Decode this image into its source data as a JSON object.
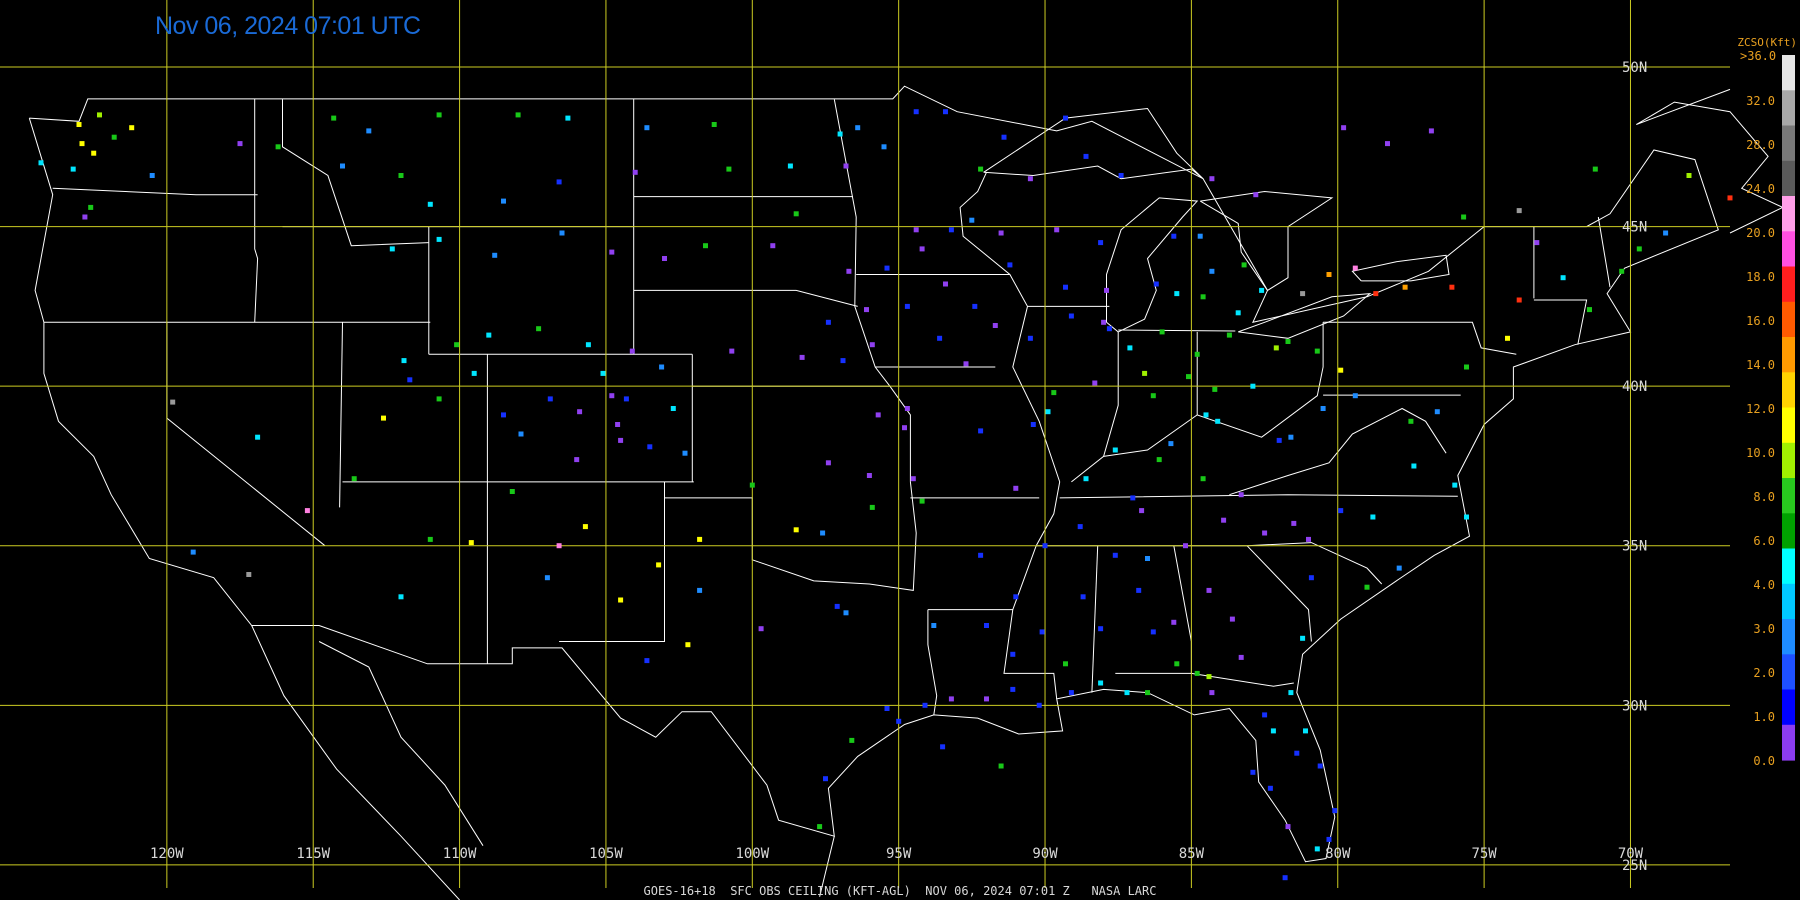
{
  "header": {
    "timestamp": "Nov 06, 2024 07:01 UTC"
  },
  "footer": {
    "caption": "GOES-16+18  SFC OBS CEILING (KFT-AGL)  NOV 06, 2024 07:01 Z   NASA LARC"
  },
  "map": {
    "projection": "equirectangular",
    "lon_range": [
      -125.7,
      -66.6
    ],
    "lat_range": [
      23.9,
      52.1
    ],
    "grid_color": "#cccc22",
    "border_color": "#ffffff",
    "longitude_lines": [
      -120,
      -115,
      -110,
      -105,
      -100,
      -95,
      -90,
      -85,
      -80,
      -75,
      -70
    ],
    "latitude_lines": [
      25,
      30,
      35,
      40,
      45,
      50
    ],
    "longitude_labels": [
      "120W",
      "115W",
      "110W",
      "105W",
      "100W",
      "95W",
      "90W",
      "85W",
      "80W",
      "75W",
      "70W"
    ],
    "latitude_labels": [
      "25N",
      "30N",
      "35N",
      "40N",
      "45N",
      "50N"
    ]
  },
  "legend": {
    "title": "ZCSO(Kft)",
    "top_label": ">36.0",
    "labels": [
      "32.0",
      "28.0",
      "24.0",
      "20.0",
      "18.0",
      "16.0",
      "14.0",
      "12.0",
      "10.0",
      "8.0",
      "6.0",
      "4.0",
      "3.0",
      "2.0",
      "1.0",
      "0.0"
    ],
    "colors_top_to_bottom": [
      "#e6e6e6",
      "#a8a8a8",
      "#787878",
      "#5a5a5a",
      "#ff9ee8",
      "#ff50e0",
      "#ff1e1e",
      "#ff5a00",
      "#ff9a00",
      "#ffd200",
      "#ffff00",
      "#a0f000",
      "#28c81e",
      "#00a000",
      "#00ffff",
      "#00c8ff",
      "#1e8cff",
      "#1e50ff",
      "#0000ff",
      "#8c3cf0"
    ]
  },
  "ceiling_colors": {
    "violet": "#9040f0",
    "blue": "#1530ff",
    "azure": "#1e8cff",
    "cyan": "#00e6ff",
    "green": "#18c818",
    "lime": "#a0f000",
    "yellow": "#ffff00",
    "orange": "#ffa000",
    "red": "#ff3010",
    "pink": "#ff80e0",
    "gray": "#9a9a9a"
  },
  "stations": [
    [
      -122.9,
      47.6,
      "yellow"
    ],
    [
      -122.5,
      47.3,
      "yellow"
    ],
    [
      -123.0,
      48.2,
      "yellow"
    ],
    [
      -122.3,
      48.5,
      "lime"
    ],
    [
      -121.8,
      47.8,
      "green"
    ],
    [
      -123.2,
      46.8,
      "cyan"
    ],
    [
      -124.3,
      47.0,
      "cyan"
    ],
    [
      -122.6,
      45.6,
      "green"
    ],
    [
      -122.8,
      45.3,
      "violet"
    ],
    [
      -121.2,
      48.1,
      "yellow"
    ],
    [
      -120.5,
      46.6,
      "azure"
    ],
    [
      -117.5,
      47.6,
      "violet"
    ],
    [
      -116.2,
      47.5,
      "green"
    ],
    [
      -114.0,
      46.9,
      "azure"
    ],
    [
      -112.0,
      46.6,
      "green"
    ],
    [
      -111.0,
      45.7,
      "cyan"
    ],
    [
      -108.5,
      45.8,
      "azure"
    ],
    [
      -106.6,
      46.4,
      "blue"
    ],
    [
      -104.0,
      46.7,
      "violet"
    ],
    [
      -100.8,
      46.8,
      "green"
    ],
    [
      -98.7,
      46.9,
      "cyan"
    ],
    [
      -96.8,
      46.9,
      "violet"
    ],
    [
      -97.0,
      47.9,
      "cyan"
    ],
    [
      -101.3,
      48.2,
      "green"
    ],
    [
      -103.6,
      48.1,
      "azure"
    ],
    [
      -106.3,
      48.4,
      "cyan"
    ],
    [
      -108.0,
      48.5,
      "green"
    ],
    [
      -110.7,
      48.5,
      "green"
    ],
    [
      -113.1,
      48.0,
      "azure"
    ],
    [
      -114.3,
      48.4,
      "green"
    ],
    [
      -112.3,
      44.3,
      "cyan"
    ],
    [
      -110.7,
      44.6,
      "cyan"
    ],
    [
      -108.8,
      44.1,
      "azure"
    ],
    [
      -106.5,
      44.8,
      "azure"
    ],
    [
      -104.8,
      44.2,
      "violet"
    ],
    [
      -103.0,
      44.0,
      "violet"
    ],
    [
      -101.6,
      44.4,
      "green"
    ],
    [
      -99.3,
      44.4,
      "violet"
    ],
    [
      -96.7,
      43.6,
      "violet"
    ],
    [
      -98.5,
      45.4,
      "green"
    ],
    [
      -94.4,
      44.9,
      "violet"
    ],
    [
      -93.2,
      44.9,
      "blue"
    ],
    [
      -92.5,
      45.2,
      "azure"
    ],
    [
      -91.5,
      44.8,
      "violet"
    ],
    [
      -89.6,
      44.9,
      "violet"
    ],
    [
      -88.1,
      44.5,
      "blue"
    ],
    [
      -87.9,
      43.0,
      "violet"
    ],
    [
      -89.3,
      43.1,
      "blue"
    ],
    [
      -91.2,
      43.8,
      "blue"
    ],
    [
      -93.4,
      43.2,
      "violet"
    ],
    [
      -95.4,
      43.7,
      "blue"
    ],
    [
      -94.2,
      44.3,
      "violet"
    ],
    [
      -96.1,
      42.4,
      "violet"
    ],
    [
      -95.9,
      41.3,
      "violet"
    ],
    [
      -94.7,
      42.5,
      "blue"
    ],
    [
      -93.6,
      41.5,
      "blue"
    ],
    [
      -92.4,
      42.5,
      "blue"
    ],
    [
      -91.7,
      41.9,
      "violet"
    ],
    [
      -90.5,
      41.5,
      "blue"
    ],
    [
      -89.1,
      42.2,
      "blue"
    ],
    [
      -88.0,
      42.0,
      "violet"
    ],
    [
      -87.8,
      41.8,
      "blue"
    ],
    [
      -88.3,
      40.1,
      "violet"
    ],
    [
      -89.7,
      39.8,
      "green"
    ],
    [
      -90.4,
      38.8,
      "blue"
    ],
    [
      -92.2,
      38.6,
      "blue"
    ],
    [
      -94.7,
      39.3,
      "violet"
    ],
    [
      -95.7,
      39.1,
      "violet"
    ],
    [
      -97.4,
      37.6,
      "violet"
    ],
    [
      -94.5,
      37.1,
      "violet"
    ],
    [
      -96.9,
      40.8,
      "blue"
    ],
    [
      -98.3,
      40.9,
      "violet"
    ],
    [
      -100.7,
      41.1,
      "violet"
    ],
    [
      -97.4,
      42.0,
      "blue"
    ],
    [
      -104.8,
      39.7,
      "violet"
    ],
    [
      -104.6,
      38.8,
      "violet"
    ],
    [
      -105.1,
      40.4,
      "cyan"
    ],
    [
      -104.3,
      39.6,
      "blue"
    ],
    [
      -105.9,
      39.2,
      "violet"
    ],
    [
      -106.9,
      39.6,
      "blue"
    ],
    [
      -107.9,
      38.5,
      "azure"
    ],
    [
      -108.5,
      39.1,
      "blue"
    ],
    [
      -106.0,
      37.7,
      "violet"
    ],
    [
      -104.5,
      38.3,
      "violet"
    ],
    [
      -103.5,
      38.1,
      "blue"
    ],
    [
      -102.7,
      39.3,
      "cyan"
    ],
    [
      -102.3,
      37.9,
      "azure"
    ],
    [
      -103.1,
      40.6,
      "azure"
    ],
    [
      -104.1,
      41.1,
      "violet"
    ],
    [
      -105.6,
      41.3,
      "cyan"
    ],
    [
      -107.3,
      41.8,
      "green"
    ],
    [
      -109.0,
      41.6,
      "cyan"
    ],
    [
      -110.1,
      41.3,
      "green"
    ],
    [
      -111.9,
      40.8,
      "cyan"
    ],
    [
      -112.6,
      39.0,
      "yellow"
    ],
    [
      -111.7,
      40.2,
      "blue"
    ],
    [
      -109.5,
      40.4,
      "cyan"
    ],
    [
      -110.7,
      39.6,
      "green"
    ],
    [
      -113.6,
      37.1,
      "green"
    ],
    [
      -115.2,
      36.1,
      "pink"
    ],
    [
      -116.9,
      38.4,
      "cyan"
    ],
    [
      -119.8,
      39.5,
      "gray"
    ],
    [
      -119.1,
      34.8,
      "azure"
    ],
    [
      -117.2,
      34.1,
      "gray"
    ],
    [
      -112.0,
      33.4,
      "cyan"
    ],
    [
      -111.0,
      35.2,
      "green"
    ],
    [
      -109.6,
      35.1,
      "yellow"
    ],
    [
      -108.2,
      36.7,
      "green"
    ],
    [
      -106.6,
      35.0,
      "pink"
    ],
    [
      -105.7,
      35.6,
      "yellow"
    ],
    [
      -107.0,
      34.0,
      "azure"
    ],
    [
      -104.5,
      33.3,
      "yellow"
    ],
    [
      -103.2,
      34.4,
      "yellow"
    ],
    [
      -101.8,
      35.2,
      "yellow"
    ],
    [
      -100.0,
      36.9,
      "green"
    ],
    [
      -98.5,
      35.5,
      "yellow"
    ],
    [
      -97.6,
      35.4,
      "azure"
    ],
    [
      -95.9,
      36.2,
      "green"
    ],
    [
      -97.1,
      33.1,
      "blue"
    ],
    [
      -96.8,
      32.9,
      "azure"
    ],
    [
      -95.4,
      29.9,
      "blue"
    ],
    [
      -95.0,
      29.5,
      "blue"
    ],
    [
      -94.1,
      30.0,
      "blue"
    ],
    [
      -93.2,
      30.2,
      "violet"
    ],
    [
      -92.0,
      30.2,
      "violet"
    ],
    [
      -91.1,
      30.5,
      "blue"
    ],
    [
      -90.2,
      30.0,
      "blue"
    ],
    [
      -89.1,
      30.4,
      "blue"
    ],
    [
      -88.1,
      30.7,
      "cyan"
    ],
    [
      -87.2,
      30.4,
      "cyan"
    ],
    [
      -86.5,
      30.4,
      "green"
    ],
    [
      -84.3,
      30.4,
      "violet"
    ],
    [
      -82.5,
      29.7,
      "blue"
    ],
    [
      -82.3,
      27.4,
      "blue"
    ],
    [
      -81.7,
      26.2,
      "violet"
    ],
    [
      -80.3,
      25.8,
      "blue"
    ],
    [
      -80.1,
      26.7,
      "blue"
    ],
    [
      -80.6,
      28.1,
      "blue"
    ],
    [
      -81.4,
      28.5,
      "blue"
    ],
    [
      -81.6,
      30.4,
      "cyan"
    ],
    [
      -82.9,
      27.9,
      "blue"
    ],
    [
      -84.4,
      33.6,
      "violet"
    ],
    [
      -83.6,
      32.7,
      "violet"
    ],
    [
      -81.2,
      32.1,
      "cyan"
    ],
    [
      -83.3,
      31.5,
      "violet"
    ],
    [
      -85.6,
      32.6,
      "violet"
    ],
    [
      -86.8,
      33.6,
      "blue"
    ],
    [
      -86.3,
      32.3,
      "blue"
    ],
    [
      -88.1,
      32.4,
      "blue"
    ],
    [
      -90.1,
      32.3,
      "blue"
    ],
    [
      -91.0,
      33.4,
      "blue"
    ],
    [
      -92.2,
      34.7,
      "blue"
    ],
    [
      -94.2,
      36.4,
      "green"
    ],
    [
      -90.0,
      35.0,
      "blue"
    ],
    [
      -88.8,
      35.6,
      "blue"
    ],
    [
      -86.7,
      36.1,
      "violet"
    ],
    [
      -85.2,
      35.0,
      "violet"
    ],
    [
      -83.9,
      35.8,
      "violet"
    ],
    [
      -82.5,
      35.4,
      "violet"
    ],
    [
      -81.0,
      35.2,
      "violet"
    ],
    [
      -79.9,
      36.1,
      "blue"
    ],
    [
      -78.8,
      35.9,
      "cyan"
    ],
    [
      -77.4,
      37.5,
      "cyan"
    ],
    [
      -76.6,
      39.2,
      "azure"
    ],
    [
      -77.5,
      38.9,
      "green"
    ],
    [
      -79.9,
      40.5,
      "yellow"
    ],
    [
      -80.7,
      41.1,
      "green"
    ],
    [
      -81.7,
      41.4,
      "green"
    ],
    [
      -82.9,
      40.0,
      "cyan"
    ],
    [
      -84.2,
      39.9,
      "green"
    ],
    [
      -84.5,
      39.1,
      "cyan"
    ],
    [
      -85.7,
      38.2,
      "azure"
    ],
    [
      -86.3,
      39.7,
      "green"
    ],
    [
      -87.6,
      38.0,
      "cyan"
    ],
    [
      -88.6,
      37.1,
      "cyan"
    ],
    [
      -86.0,
      41.7,
      "green"
    ],
    [
      -85.5,
      42.9,
      "cyan"
    ],
    [
      -84.6,
      42.8,
      "green"
    ],
    [
      -83.4,
      42.3,
      "cyan"
    ],
    [
      -83.7,
      41.6,
      "green"
    ],
    [
      -82.6,
      43.0,
      "cyan"
    ],
    [
      -84.7,
      44.7,
      "azure"
    ],
    [
      -85.6,
      44.7,
      "blue"
    ],
    [
      -87.4,
      46.6,
      "blue"
    ],
    [
      -88.6,
      47.2,
      "blue"
    ],
    [
      -90.5,
      46.5,
      "violet"
    ],
    [
      -92.2,
      46.8,
      "green"
    ],
    [
      -95.5,
      47.5,
      "azure"
    ],
    [
      -94.4,
      48.6,
      "blue"
    ],
    [
      -96.4,
      48.1,
      "azure"
    ],
    [
      -93.4,
      48.6,
      "blue"
    ],
    [
      -78.7,
      42.9,
      "red"
    ],
    [
      -76.1,
      43.1,
      "red"
    ],
    [
      -77.7,
      43.1,
      "orange"
    ],
    [
      -73.8,
      42.7,
      "red"
    ],
    [
      -74.2,
      41.5,
      "yellow"
    ],
    [
      -75.6,
      40.6,
      "green"
    ],
    [
      -73.2,
      44.5,
      "violet"
    ],
    [
      -72.3,
      43.4,
      "cyan"
    ],
    [
      -71.4,
      42.4,
      "green"
    ],
    [
      -70.3,
      43.6,
      "green"
    ],
    [
      -69.7,
      44.3,
      "green"
    ],
    [
      -68.8,
      44.8,
      "azure"
    ],
    [
      -68.0,
      46.6,
      "lime"
    ],
    [
      -66.6,
      45.9,
      "red"
    ],
    [
      -79.4,
      43.7,
      "pink"
    ],
    [
      -81.2,
      42.9,
      "gray"
    ],
    [
      -80.3,
      43.5,
      "orange"
    ],
    [
      -75.7,
      45.3,
      "green"
    ],
    [
      -78.3,
      47.6,
      "violet"
    ],
    [
      -79.8,
      48.1,
      "violet"
    ],
    [
      -76.8,
      48.0,
      "violet"
    ],
    [
      -73.8,
      45.5,
      "gray"
    ],
    [
      -71.2,
      46.8,
      "green"
    ],
    [
      -83.2,
      43.8,
      "green"
    ],
    [
      -82.1,
      41.2,
      "lime"
    ],
    [
      -84.8,
      41.0,
      "green"
    ],
    [
      -87.1,
      41.2,
      "cyan"
    ],
    [
      -86.6,
      40.4,
      "lime"
    ],
    [
      -85.1,
      40.3,
      "green"
    ],
    [
      -84.1,
      38.9,
      "cyan"
    ],
    [
      -82.0,
      38.3,
      "blue"
    ],
    [
      -80.5,
      39.3,
      "azure"
    ],
    [
      -81.6,
      38.4,
      "azure"
    ],
    [
      -79.4,
      39.7,
      "azure"
    ],
    [
      -86.1,
      37.7,
      "green"
    ],
    [
      -87.0,
      36.5,
      "blue"
    ],
    [
      -84.6,
      37.1,
      "green"
    ],
    [
      -83.3,
      36.6,
      "violet"
    ],
    [
      -81.5,
      35.7,
      "violet"
    ],
    [
      -80.9,
      34.0,
      "blue"
    ],
    [
      -79.0,
      33.7,
      "green"
    ],
    [
      -77.9,
      34.3,
      "azure"
    ],
    [
      -76.0,
      36.9,
      "cyan"
    ],
    [
      -75.6,
      35.9,
      "cyan"
    ],
    [
      -96.6,
      28.9,
      "green"
    ],
    [
      -97.5,
      27.7,
      "blue"
    ],
    [
      -97.7,
      26.2,
      "green"
    ],
    [
      -99.7,
      32.4,
      "violet"
    ],
    [
      -101.8,
      33.6,
      "azure"
    ],
    [
      -102.2,
      31.9,
      "yellow"
    ],
    [
      -103.6,
      31.4,
      "blue"
    ],
    [
      -93.8,
      32.5,
      "azure"
    ],
    [
      -92.0,
      32.5,
      "blue"
    ],
    [
      -91.1,
      31.6,
      "blue"
    ],
    [
      -89.3,
      31.3,
      "green"
    ],
    [
      -88.7,
      33.4,
      "blue"
    ],
    [
      -87.6,
      34.7,
      "blue"
    ],
    [
      -86.5,
      34.6,
      "azure"
    ],
    [
      -85.5,
      31.3,
      "green"
    ],
    [
      -84.8,
      31.0,
      "green"
    ],
    [
      -84.4,
      30.9,
      "lime"
    ],
    [
      -82.2,
      29.2,
      "cyan"
    ],
    [
      -81.1,
      29.2,
      "cyan"
    ],
    [
      -80.7,
      25.5,
      "cyan"
    ],
    [
      -81.8,
      24.6,
      "blue"
    ],
    [
      -91.5,
      28.1,
      "green"
    ],
    [
      -93.5,
      28.7,
      "blue"
    ],
    [
      -82.8,
      46.0,
      "violet"
    ],
    [
      -84.3,
      46.5,
      "violet"
    ],
    [
      -89.3,
      48.4,
      "blue"
    ],
    [
      -91.4,
      47.8,
      "blue"
    ],
    [
      -84.3,
      43.6,
      "azure"
    ],
    [
      -86.2,
      43.2,
      "blue"
    ],
    [
      -89.9,
      39.2,
      "cyan"
    ],
    [
      -91.0,
      36.8,
      "violet"
    ],
    [
      -92.7,
      40.7,
      "violet"
    ],
    [
      -94.8,
      38.7,
      "violet"
    ],
    [
      -96.0,
      37.2,
      "violet"
    ]
  ]
}
